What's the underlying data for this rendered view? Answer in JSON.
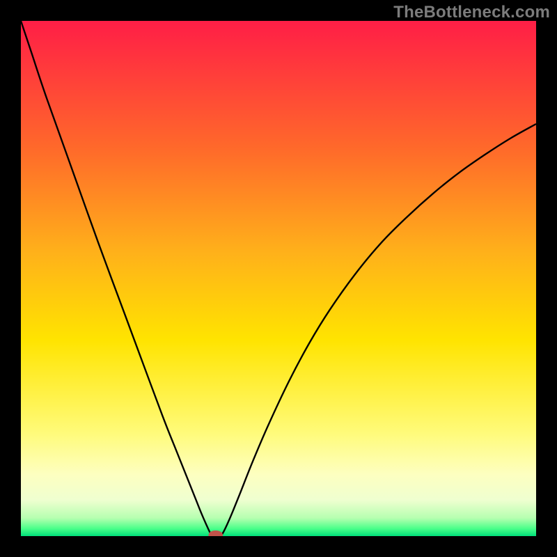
{
  "watermark": "TheBottleneck.com",
  "chart_data": {
    "type": "line",
    "title": "",
    "xlabel": "",
    "ylabel": "",
    "xlim": [
      0,
      100
    ],
    "ylim": [
      0,
      100
    ],
    "background": {
      "gradient_stops": [
        {
          "pos": 0.0,
          "color": "#ff1e46"
        },
        {
          "pos": 0.25,
          "color": "#ff6a2a"
        },
        {
          "pos": 0.45,
          "color": "#ffb11a"
        },
        {
          "pos": 0.62,
          "color": "#ffe400"
        },
        {
          "pos": 0.8,
          "color": "#fffb7a"
        },
        {
          "pos": 0.88,
          "color": "#fdffc0"
        },
        {
          "pos": 0.93,
          "color": "#efffd0"
        },
        {
          "pos": 0.965,
          "color": "#b6ffb0"
        },
        {
          "pos": 0.985,
          "color": "#4cff8a"
        },
        {
          "pos": 1.0,
          "color": "#00e07a"
        }
      ]
    },
    "series": [
      {
        "name": "bottleneck-curve",
        "stroke": "#000000",
        "data": [
          {
            "x": 0,
            "y": 100
          },
          {
            "x": 2,
            "y": 94
          },
          {
            "x": 5,
            "y": 85
          },
          {
            "x": 10,
            "y": 71
          },
          {
            "x": 15,
            "y": 57
          },
          {
            "x": 20,
            "y": 43.5
          },
          {
            "x": 25,
            "y": 30
          },
          {
            "x": 28,
            "y": 22
          },
          {
            "x": 30,
            "y": 17
          },
          {
            "x": 32,
            "y": 12
          },
          {
            "x": 34,
            "y": 7
          },
          {
            "x": 35,
            "y": 4.5
          },
          {
            "x": 36,
            "y": 2.2
          },
          {
            "x": 36.8,
            "y": 0.5
          },
          {
            "x": 37.2,
            "y": 0
          },
          {
            "x": 38.6,
            "y": 0
          },
          {
            "x": 39.2,
            "y": 0.6
          },
          {
            "x": 40,
            "y": 2.2
          },
          {
            "x": 41,
            "y": 4.5
          },
          {
            "x": 42.5,
            "y": 8.2
          },
          {
            "x": 45,
            "y": 14.5
          },
          {
            "x": 48,
            "y": 21.5
          },
          {
            "x": 52,
            "y": 30
          },
          {
            "x": 56,
            "y": 37.5
          },
          {
            "x": 60,
            "y": 44
          },
          {
            "x": 65,
            "y": 51
          },
          {
            "x": 70,
            "y": 57
          },
          {
            "x": 75,
            "y": 62
          },
          {
            "x": 80,
            "y": 66.5
          },
          {
            "x": 85,
            "y": 70.5
          },
          {
            "x": 90,
            "y": 74
          },
          {
            "x": 95,
            "y": 77.2
          },
          {
            "x": 100,
            "y": 80
          }
        ]
      }
    ],
    "marker": {
      "name": "optimal-point",
      "x": 37.8,
      "y": 0.2,
      "color": "#c2524a",
      "rx": 1.4,
      "ry": 0.9
    }
  }
}
